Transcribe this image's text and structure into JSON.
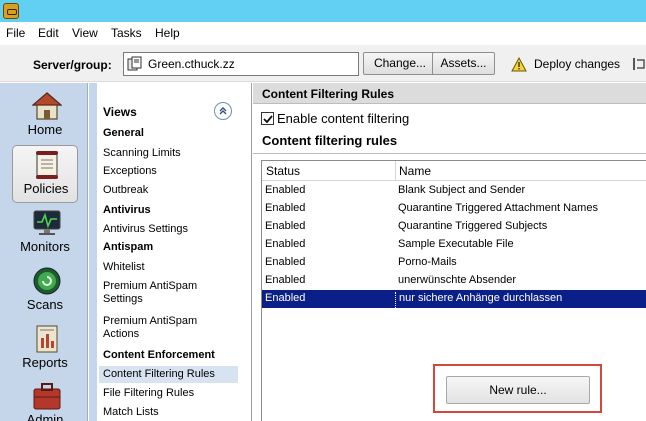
{
  "menu": [
    "File",
    "Edit",
    "View",
    "Tasks",
    "Help"
  ],
  "toolbar": {
    "server_group_label": "Server/group:",
    "server_group_value": "Green.cthuck.zz",
    "change_label": "Change...",
    "assets_label": "Assets...",
    "deploy_label": "Deploy changes"
  },
  "leftnav": {
    "items": [
      {
        "label": "Home",
        "icon": "home-icon"
      },
      {
        "label": "Policies",
        "icon": "policies-icon",
        "selected": true
      },
      {
        "label": "Monitors",
        "icon": "monitor-icon"
      },
      {
        "label": "Scans",
        "icon": "scan-icon"
      },
      {
        "label": "Reports",
        "icon": "reports-icon"
      },
      {
        "label": "Admin",
        "icon": "admin-icon"
      }
    ]
  },
  "views": {
    "header": "Views",
    "categories": {
      "general": "General",
      "antivirus": "Antivirus",
      "antispam": "Antispam",
      "content_enforcement": "Content Enforcement"
    },
    "items": {
      "scanning_limits": "Scanning Limits",
      "exceptions": "Exceptions",
      "outbreak": "Outbreak",
      "antivirus_settings": "Antivirus Settings",
      "whitelist": "Whitelist",
      "premium_antispam_settings": "Premium AntiSpam Settings",
      "premium_antispam_actions": "Premium AntiSpam Actions",
      "content_filtering_rules": "Content Filtering Rules",
      "file_filtering_rules": "File Filtering Rules",
      "match_lists": "Match Lists"
    },
    "selected": "Content Filtering Rules"
  },
  "content": {
    "header": "Content Filtering Rules",
    "enable_label": "Enable content filtering",
    "enable_checked": true,
    "section_title": "Content filtering rules",
    "columns": [
      "Status",
      "Name"
    ],
    "rows": [
      {
        "status": "Enabled",
        "name": "Blank Subject and Sender"
      },
      {
        "status": "Enabled",
        "name": "Quarantine Triggered Attachment Names"
      },
      {
        "status": "Enabled",
        "name": "Quarantine Triggered Subjects"
      },
      {
        "status": "Enabled",
        "name": "Sample Executable File"
      },
      {
        "status": "Enabled",
        "name": "Porno-Mails"
      },
      {
        "status": "Enabled",
        "name": "unerwünschte Absender"
      },
      {
        "status": "Enabled",
        "name": "nur sichere Anhänge durchlassen"
      }
    ],
    "selected_row": 6,
    "new_rule_label": "New rule..."
  },
  "colors": {
    "titlebar": "#62d0f3",
    "nav_background": "#c5d6ea",
    "selection": "#0b1f88",
    "highlight_box": "#d5473b"
  }
}
